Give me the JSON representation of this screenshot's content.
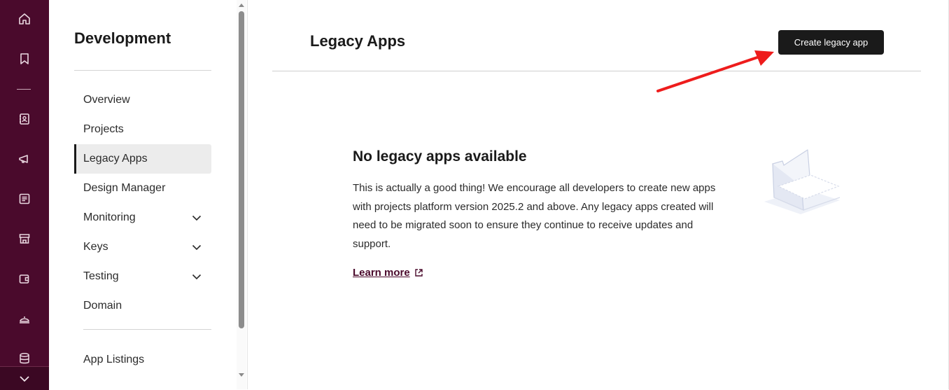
{
  "rail": {
    "icons": [
      "home-icon",
      "bookmark-icon",
      "contacts-icon",
      "megaphone-icon",
      "content-icon",
      "store-icon",
      "wallet-icon",
      "service-bell-icon",
      "database-icon",
      "chevron-down-icon"
    ]
  },
  "sidebar": {
    "title": "Development",
    "items": [
      {
        "label": "Overview"
      },
      {
        "label": "Projects"
      },
      {
        "label": "Legacy Apps"
      },
      {
        "label": "Design Manager"
      },
      {
        "label": "Monitoring"
      },
      {
        "label": "Keys"
      },
      {
        "label": "Testing"
      },
      {
        "label": "Domain"
      }
    ],
    "bottom_item": "App Listings"
  },
  "main": {
    "title": "Legacy Apps",
    "create_button": "Create legacy app",
    "empty_title": "No legacy apps available",
    "empty_body": "This is actually a good thing! We encourage all developers to create new apps with projects platform version 2025.2 and above. Any legacy apps created will need to be migrated soon to ensure they continue to receive updates and support.",
    "learn_more": "Learn more"
  },
  "colors": {
    "rail": "#4a0a2c",
    "button": "#1a1a1a",
    "arrow": "#ee1c1c",
    "link": "#4a0a2c"
  }
}
